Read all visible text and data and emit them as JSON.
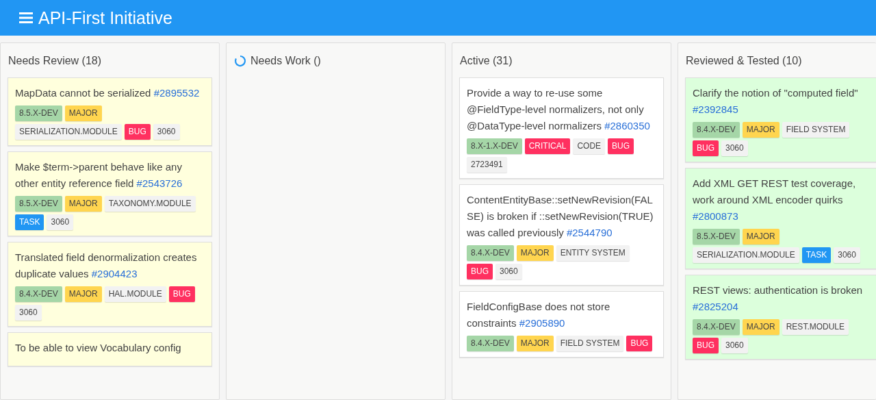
{
  "app_bar": {
    "title": "API-First Initiative"
  },
  "columns": [
    {
      "title": "Needs Review (18)",
      "color": "#ffffdd",
      "loading": false,
      "cards": [
        {
          "title": "MapData cannot be serialized",
          "issue": "#2895532",
          "tags": [
            {
              "label": "8.5.X-DEV",
              "kind": "version"
            },
            {
              "label": "MAJOR",
              "kind": "major"
            },
            {
              "label": "SERIALIZATION.MODULE",
              "kind": "component"
            },
            {
              "label": "BUG",
              "kind": "bug"
            },
            {
              "label": "3060",
              "kind": "plain"
            }
          ]
        },
        {
          "title": "Make $term->parent behave like any other entity reference field",
          "issue": "#2543726",
          "tags": [
            {
              "label": "8.5.X-DEV",
              "kind": "version"
            },
            {
              "label": "MAJOR",
              "kind": "major"
            },
            {
              "label": "TAXONOMY.MODULE",
              "kind": "component"
            },
            {
              "label": "TASK",
              "kind": "task"
            },
            {
              "label": "3060",
              "kind": "plain"
            }
          ]
        },
        {
          "title": "Translated field denormalization creates duplicate values",
          "issue": "#2904423",
          "tags": [
            {
              "label": "8.4.X-DEV",
              "kind": "version"
            },
            {
              "label": "MAJOR",
              "kind": "major"
            },
            {
              "label": "HAL.MODULE",
              "kind": "component"
            },
            {
              "label": "BUG",
              "kind": "bug"
            },
            {
              "label": "3060",
              "kind": "plain"
            }
          ]
        },
        {
          "title": "To be able to view Vocabulary config"
        }
      ]
    },
    {
      "title": "Needs Work ()",
      "loading": true
    },
    {
      "title": "Active (31)",
      "color": "#ffffff",
      "loading": false,
      "cards": [
        {
          "title": "Provide a way to re-use some @FieldType-level normalizers, not only @DataType-level normalizers",
          "issue": "#2860350",
          "tags": [
            {
              "label": "8.X-1.X-DEV",
              "kind": "version"
            },
            {
              "label": "CRITICAL",
              "kind": "critical"
            },
            {
              "label": "CODE",
              "kind": "component"
            },
            {
              "label": "BUG",
              "kind": "bug"
            },
            {
              "label": "2723491",
              "kind": "plain"
            }
          ]
        },
        {
          "title": "ContentEntityBase::setNewRevision(FALSE) is broken if ::setNewRevision(TRUE) was called previously",
          "issue": "#2544790",
          "tags": [
            {
              "label": "8.4.X-DEV",
              "kind": "version"
            },
            {
              "label": "MAJOR",
              "kind": "major"
            },
            {
              "label": "ENTITY SYSTEM",
              "kind": "component"
            },
            {
              "label": "BUG",
              "kind": "bug"
            },
            {
              "label": "3060",
              "kind": "plain"
            }
          ]
        },
        {
          "title": "FieldConfigBase does not store constraints",
          "issue": "#2905890",
          "tags": [
            {
              "label": "8.4.X-DEV",
              "kind": "version"
            },
            {
              "label": "MAJOR",
              "kind": "major"
            },
            {
              "label": "FIELD SYSTEM",
              "kind": "component"
            },
            {
              "label": "BUG",
              "kind": "bug"
            }
          ]
        }
      ]
    },
    {
      "title": "Reviewed & Tested (10)",
      "color": "#dcffdc",
      "loading": false,
      "cards": [
        {
          "title": "Clarify the notion of \"computed field\"",
          "issue": "#2392845",
          "tags": [
            {
              "label": "8.4.X-DEV",
              "kind": "version"
            },
            {
              "label": "MAJOR",
              "kind": "major"
            },
            {
              "label": "FIELD SYSTEM",
              "kind": "component"
            },
            {
              "label": "BUG",
              "kind": "bug"
            },
            {
              "label": "3060",
              "kind": "plain"
            }
          ]
        },
        {
          "title": "Add XML GET REST test coverage, work around XML encoder quirks",
          "issue": "#2800873",
          "tags": [
            {
              "label": "8.5.X-DEV",
              "kind": "version"
            },
            {
              "label": "MAJOR",
              "kind": "major"
            },
            {
              "label": "SERIALIZATION.MODULE",
              "kind": "component"
            },
            {
              "label": "TASK",
              "kind": "task"
            },
            {
              "label": "3060",
              "kind": "plain"
            }
          ]
        },
        {
          "title": "REST views: authentication is broken",
          "issue": "#2825204",
          "tags": [
            {
              "label": "8.4.X-DEV",
              "kind": "version"
            },
            {
              "label": "MAJOR",
              "kind": "major"
            },
            {
              "label": "REST.MODULE",
              "kind": "component"
            },
            {
              "label": "BUG",
              "kind": "bug"
            },
            {
              "label": "3060",
              "kind": "plain"
            }
          ]
        }
      ]
    }
  ]
}
